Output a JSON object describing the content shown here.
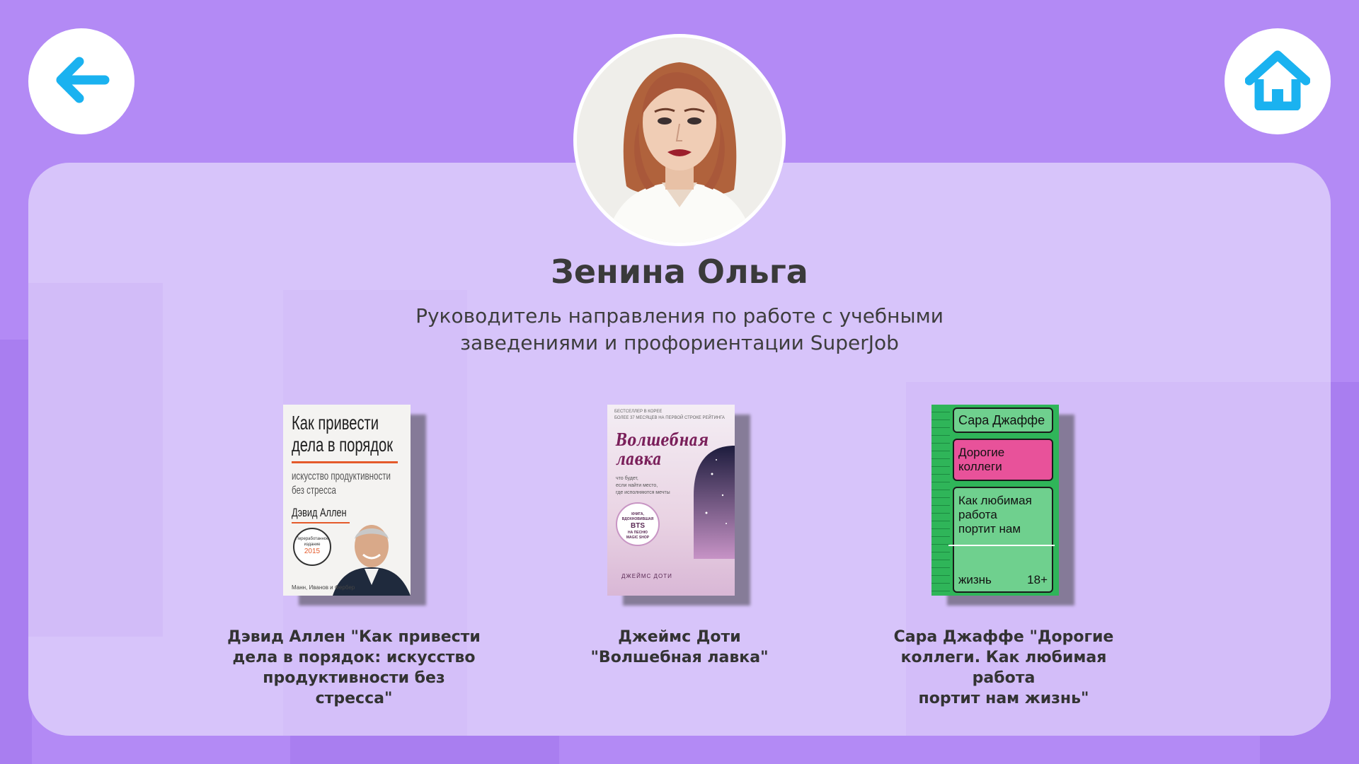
{
  "nav": {
    "back_icon": "arrow-left-icon",
    "home_icon": "house-icon",
    "icon_color": "#1ab2f0"
  },
  "profile": {
    "name": "Зенина Ольга",
    "role_line1": "Руководитель направления по работе с учебными",
    "role_line2": "заведениями и профориентации SuperJob"
  },
  "books": [
    {
      "caption_line1": "Дэвид Аллен \"Как привести",
      "caption_line2": "дела в порядок: искусство",
      "caption_line3": "продуктивности без стресса\"",
      "cover": {
        "title_line1": "Как привести",
        "title_line2": "дела в порядок",
        "subtitle_line1": "искусство продуктивности",
        "subtitle_line2": "без стресса",
        "author": "Дэвид Аллен",
        "badge_line1": "Переработанное",
        "badge_line2": "издание",
        "badge_year": "2015",
        "publisher": "Манн, Иванов и Фербер"
      }
    },
    {
      "caption_line1": "Джеймс Доти",
      "caption_line2": "\"Волшебная лавка\"",
      "caption_line3": "",
      "cover": {
        "top_line1": "БЕСТСЕЛЛЕР В КОРЕЕ",
        "top_line2": "БОЛЕЕ 37 МЕСЯЦЕВ НА ПЕРВОЙ СТРОКЕ РЕЙТИНГА",
        "title_line1": "Волшебная",
        "title_line2": "лавка",
        "tagline1": "что будет,",
        "tagline2": "если найти место,",
        "tagline3": "где исполняются мечты",
        "badge_line1": "КНИГА,",
        "badge_line2": "ВДОХНОВИВШАЯ",
        "badge_line3": "BTS",
        "badge_line4": "НА ПЕСНЮ",
        "badge_line5": "MAGIC SHOP",
        "author": "ДЖЕЙМС ДОТИ"
      }
    },
    {
      "caption_line1": "Сара Джаффе \"Дорогие",
      "caption_line2": "коллеги. Как любимая работа",
      "caption_line3": "портит нам жизнь\"",
      "cover": {
        "author": "Сара Джаффе",
        "title_line1": "Дорогие",
        "title_line2": "коллеги",
        "sub_line1": "Как любимая",
        "sub_line2": "работа",
        "sub_line3": "портит нам",
        "bottom_word": "жизнь",
        "age": "18+",
        "color_green": "#2fb559",
        "color_pink": "#e8529a"
      }
    }
  ]
}
